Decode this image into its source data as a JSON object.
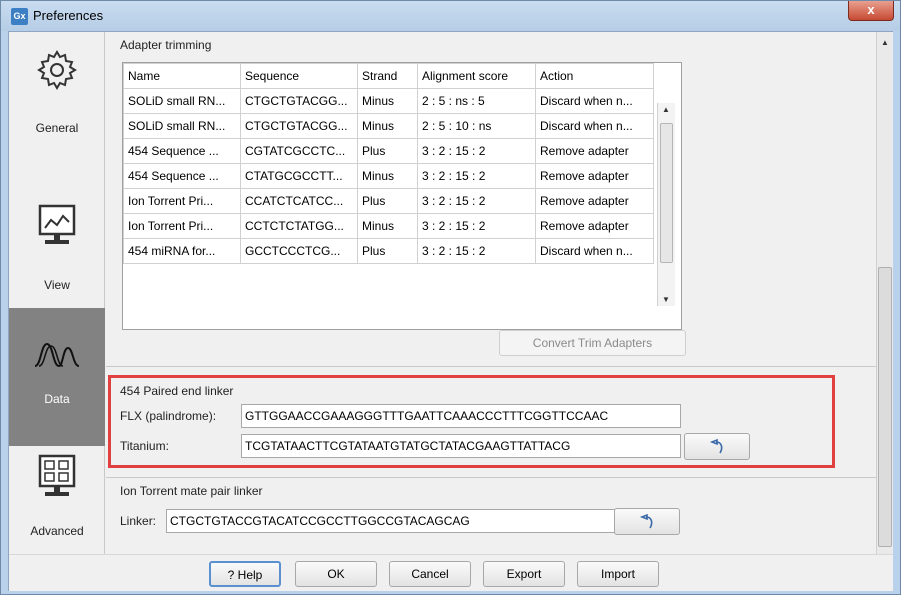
{
  "window": {
    "title": "Preferences",
    "app_icon_text": "Gx",
    "close_glyph": "x"
  },
  "sidebar": {
    "items": [
      {
        "label": "General",
        "icon": "gear-icon"
      },
      {
        "label": "View",
        "icon": "monitor-chart-icon"
      },
      {
        "label": "Data",
        "icon": "waveform-icon"
      },
      {
        "label": "Advanced",
        "icon": "checkbox-monitor-icon"
      }
    ],
    "active": "Data"
  },
  "adapter_trimming": {
    "title": "Adapter trimming",
    "columns": [
      "Name",
      "Sequence",
      "Strand",
      "Alignment score",
      "Action"
    ],
    "rows": [
      [
        "SOLiD small RN...",
        "CTGCTGTACGG...",
        "Minus",
        "2 : 5 : ns : 5",
        "Discard when n..."
      ],
      [
        "SOLiD small RN...",
        "CTGCTGTACGG...",
        "Minus",
        "2 : 5 : 10 : ns",
        "Discard when n..."
      ],
      [
        "454 Sequence ...",
        "CGTATCGCCTC...",
        "Plus",
        "3 : 2 : 15 : 2",
        "Remove adapter"
      ],
      [
        "454 Sequence ...",
        "CTATGCGCCTT...",
        "Minus",
        "3 : 2 : 15 : 2",
        "Remove adapter"
      ],
      [
        "Ion Torrent Pri...",
        "CCATCTCATCC...",
        "Plus",
        "3 : 2 : 15 : 2",
        "Remove adapter"
      ],
      [
        "Ion Torrent Pri...",
        "CCTCTCTATGG...",
        "Minus",
        "3 : 2 : 15 : 2",
        "Remove adapter"
      ],
      [
        "454 miRNA for...",
        "GCCTCCCTCG...",
        "Plus",
        "3 : 2 : 15 : 2",
        "Discard when n..."
      ]
    ],
    "convert_button": "Convert Trim Adapters"
  },
  "paired_linker": {
    "title": "454 Paired end linker",
    "flx_label": "FLX (palindrome):",
    "flx_value": "GTTGGAACCGAAAGGGTTTGAATTCAAACCCTTTCGGTTCCAAC",
    "titanium_label": "Titanium:",
    "titanium_value": "TCGTATAACTTCGTATAATGTATGCTATACGAAGTTATTACG"
  },
  "ion_linker": {
    "title": "Ion Torrent mate pair linker",
    "linker_label": "Linker:",
    "linker_value": "CTGCTGTACCGTACATCCGCCTTGGCCGTACAGCAG"
  },
  "buttons": {
    "help": "? Help",
    "ok": "OK",
    "cancel": "Cancel",
    "export": "Export",
    "import": "Import"
  },
  "colors": {
    "highlight": "#e04040",
    "active_sidebar": "#828282"
  }
}
